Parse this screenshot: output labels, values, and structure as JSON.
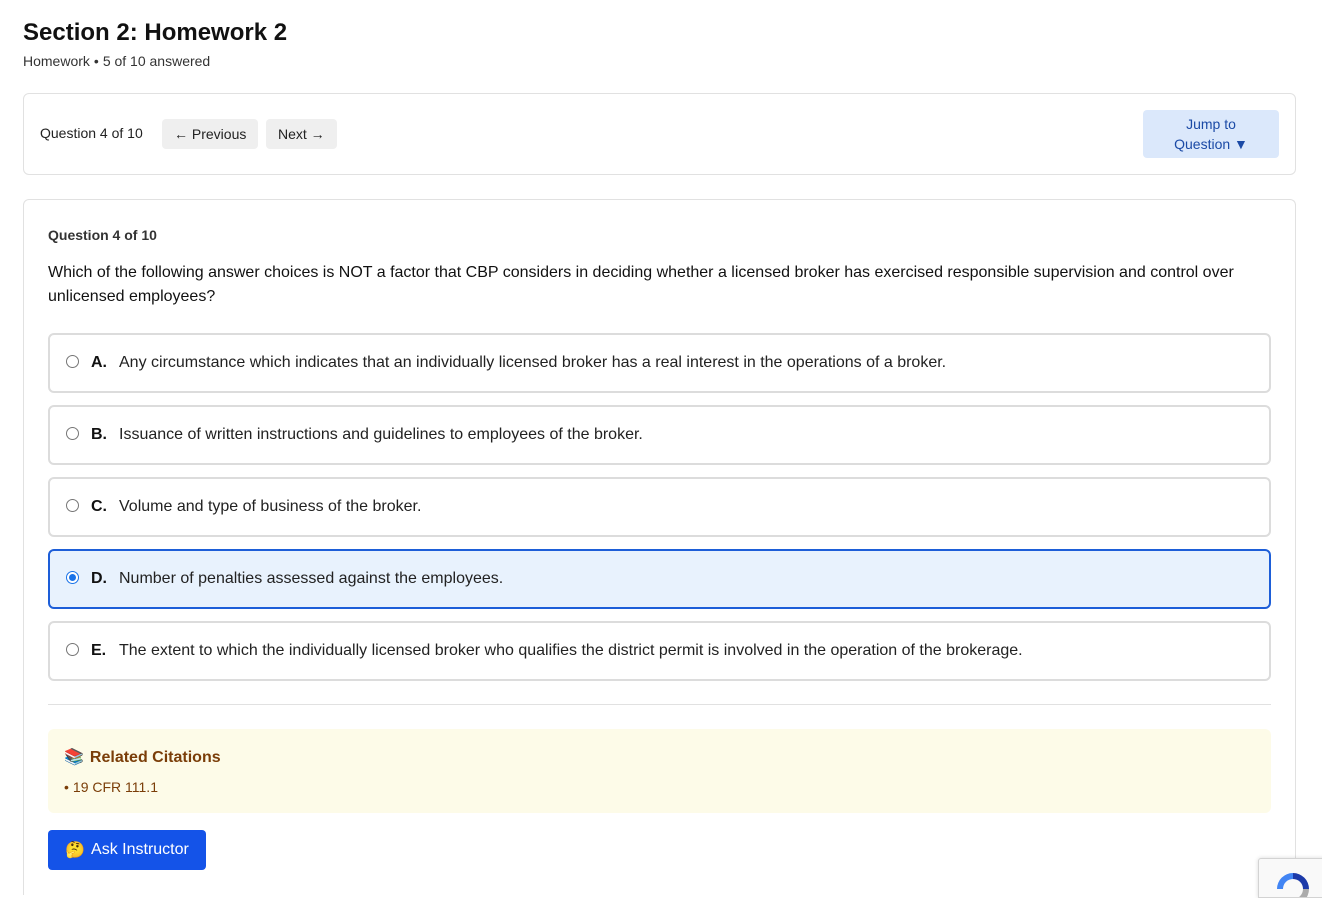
{
  "header": {
    "title": "Section 2: Homework 2",
    "type": "Homework",
    "separator": "•",
    "progress": "5 of 10 answered"
  },
  "nav": {
    "position_label": "Question 4 of 10",
    "previous_label": "← Previous",
    "next_label": "Next →",
    "jump_label_line1": "Jump to",
    "jump_label_line2": "Question ▼"
  },
  "question": {
    "number_label": "Question 4 of 10",
    "text": "Which of the following answer choices is NOT a factor that CBP considers in deciding whether a licensed broker has exercised responsible supervision and control over unlicensed employees?",
    "selected": "D",
    "options": [
      {
        "letter": "A.",
        "text": "Any circumstance which indicates that an individually licensed broker has a real interest in the operations of a broker."
      },
      {
        "letter": "B.",
        "text": "Issuance of written instructions and guidelines to employees of the broker."
      },
      {
        "letter": "C.",
        "text": "Volume and type of business of the broker."
      },
      {
        "letter": "D.",
        "text": "Number of penalties assessed against the employees."
      },
      {
        "letter": "E.",
        "text": "The extent to which the individually licensed broker who qualifies the district permit is involved in the operation of the brokerage."
      }
    ]
  },
  "citations": {
    "icon": "books-emoji",
    "title": "Related Citations",
    "items": [
      {
        "bullet": "•",
        "text": "19 CFR 111.1"
      }
    ]
  },
  "ask": {
    "icon": "thinking-face-emoji",
    "label": "Ask Instructor"
  },
  "colors": {
    "accent": "#1453e8",
    "selected_border": "#1d5ed8",
    "selected_bg": "#e8f2fd",
    "citation_bg": "#fdfbe8",
    "citation_text": "#7a3d08",
    "jump_bg": "#dbe8fb"
  }
}
